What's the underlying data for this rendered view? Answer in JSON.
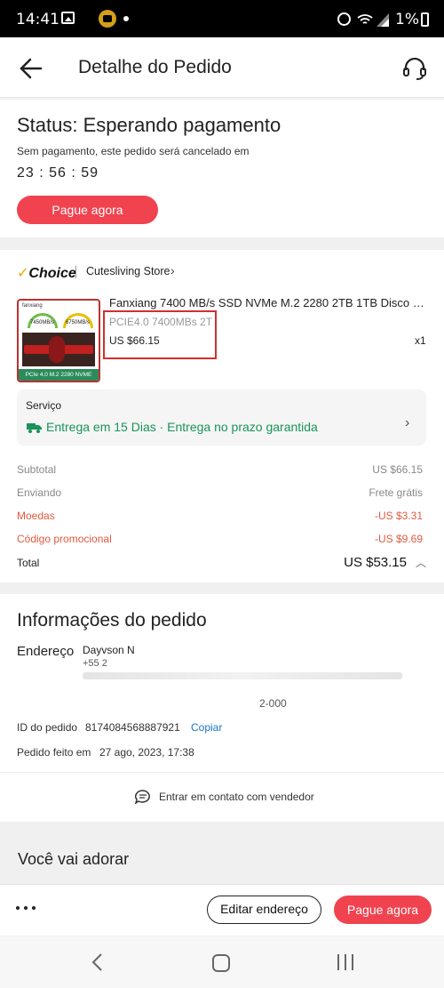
{
  "status_bar": {
    "time": "14:41",
    "battery": "1%"
  },
  "header": {
    "title": "Detalhe do Pedido"
  },
  "status": {
    "title": "Status: Esperando pagamento",
    "subtitle": "Sem pagamento, este pedido será cancelado em",
    "countdown": "23 : 56 : 59",
    "pay_button": "Pague agora"
  },
  "store": {
    "badge": "Choice",
    "name": "Cutesliving Store"
  },
  "product": {
    "title": "Fanxiang 7400 MB/s SSD NVMe M.2 2280 2TB 1TB Disco Rí...",
    "variant": "PCIE4.0 7400MBs 2T",
    "price": "US $66.15",
    "quantity": "x1",
    "image": {
      "brand": "fanxiang",
      "speed1": "7450MB/s",
      "speed2": "6750MB/s",
      "label": "PCIe 4.0 M.2 2280 NVME"
    }
  },
  "service": {
    "label": "Serviço",
    "delivery": "Entrega em 15 Dias · Entrega no prazo garantida"
  },
  "summary": {
    "subtotal_label": "Subtotal",
    "subtotal_value": "US $66.15",
    "shipping_label": "Enviando",
    "shipping_value": "Frete grátis",
    "coins_label": "Moedas",
    "coins_value": "-US $3.31",
    "promo_label": "Código promocional",
    "promo_value": "-US $9.69",
    "total_label": "Total",
    "total_value": "US $53.15"
  },
  "order_info": {
    "title": "Informações do pedido",
    "address_label": "Endereço",
    "address_name": "Dayvson N",
    "address_phone": "+55 2",
    "address_cep": "2-000",
    "order_id_label": "ID do pedido",
    "order_id": "8174084568887921",
    "copy_label": "Copiar",
    "placed_label": "Pedido feito em",
    "placed_value": "27 ago, 2023, 17:38",
    "contact_label": "Entrar em contato com vendedor"
  },
  "recommend": {
    "title": "Você vai adorar"
  },
  "bottom_bar": {
    "edit_label": "Editar endereço",
    "pay_label": "Pague agora"
  },
  "colors": {
    "accent": "#f0434f",
    "green": "#19945a",
    "discount": "#e05a40",
    "link": "#1a73c8"
  }
}
